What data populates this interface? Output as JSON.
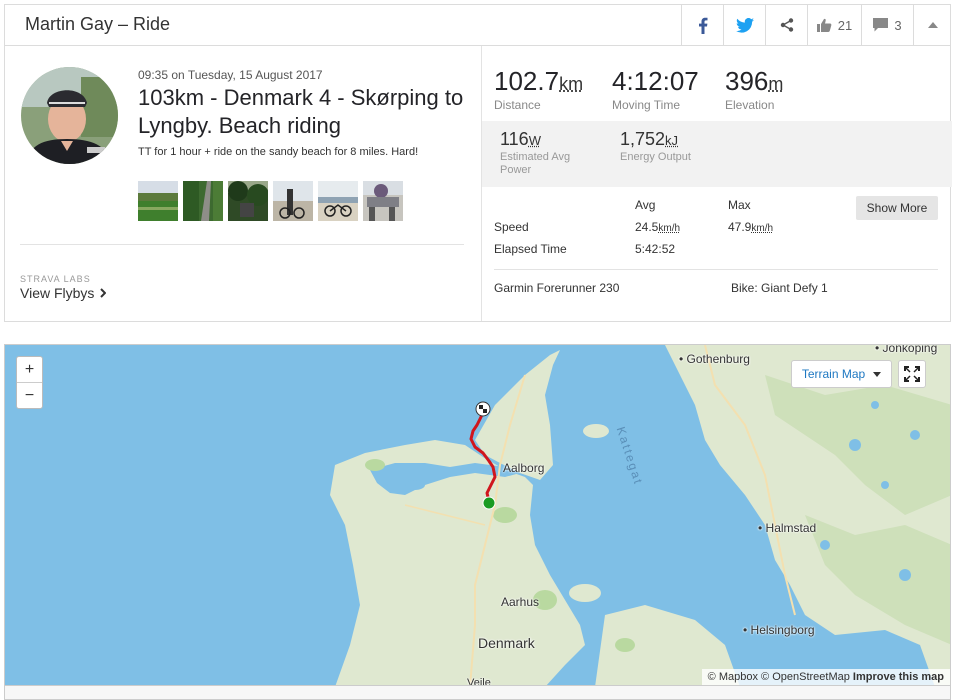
{
  "header": {
    "title": "Martin Gay – Ride",
    "kudos_count": "21",
    "comments_count": "3"
  },
  "activity": {
    "date": "09:35 on Tuesday, 15 August 2017",
    "title": "103km - Denmark 4 - Skørping to Lyngby. Beach riding",
    "description": "TT for 1 hour + ride on the sandy beach for 8 miles. Hard!",
    "labs_label": "STRAVA LABS",
    "flybys_label": "View Flybys"
  },
  "stats": {
    "distance": {
      "value": "102.7",
      "unit": "km",
      "label": "Distance"
    },
    "moving_time": {
      "value": "4:12:07",
      "label": "Moving Time"
    },
    "elevation": {
      "value": "396",
      "unit": "m",
      "label": "Elevation"
    },
    "power": {
      "value": "116",
      "unit": "W",
      "label": "Estimated Avg Power"
    },
    "energy": {
      "value": "1,752",
      "unit": "kJ",
      "label": "Energy Output"
    }
  },
  "table": {
    "avg_header": "Avg",
    "max_header": "Max",
    "speed_label": "Speed",
    "speed_avg": "24.5",
    "speed_max": "47.9",
    "speed_unit": "km/h",
    "elapsed_label": "Elapsed Time",
    "elapsed_avg": "5:42:52",
    "show_more": "Show More"
  },
  "device": "Garmin Forerunner 230",
  "bike": "Bike: Giant Defy 1",
  "map": {
    "zoom_in": "+",
    "zoom_out": "−",
    "terrain_label": "Terrain Map",
    "cities": {
      "gothenburg": "Gothenburg",
      "jonkoping": "Jönköping",
      "aalborg": "Aalborg",
      "halmstad": "Halmstad",
      "aarhus": "Aarhus",
      "denmark": "Denmark",
      "helsingborg": "Helsingborg",
      "vejle": "Vejle"
    },
    "sea_label": "Kattegat",
    "attribution_mapbox": "© Mapbox",
    "attribution_osm": "© OpenStreetMap",
    "attribution_improve": "Improve this map",
    "route_color": "#d0161d",
    "start_color": "#1a9b22"
  }
}
